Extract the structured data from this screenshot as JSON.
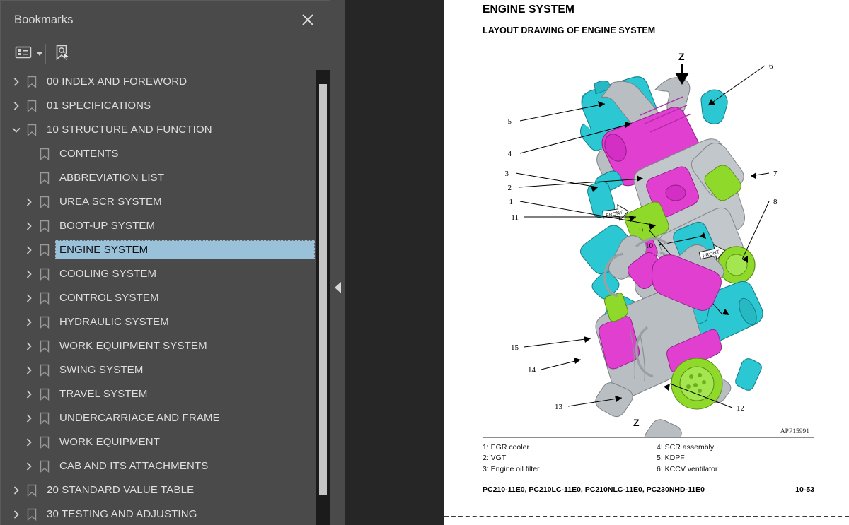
{
  "sidebar": {
    "title": "Bookmarks",
    "close_icon": "close-icon",
    "toolbar": {
      "list_options_icon": "list-options-icon",
      "find_bookmark_icon": "find-bookmark-icon"
    },
    "tree": [
      {
        "label": "00 INDEX AND FOREWORD",
        "level": 1,
        "expander": "collapsed",
        "selected": false
      },
      {
        "label": "01 SPECIFICATIONS",
        "level": 1,
        "expander": "collapsed",
        "selected": false
      },
      {
        "label": "10 STRUCTURE AND FUNCTION",
        "level": 1,
        "expander": "expanded",
        "selected": false
      },
      {
        "label": "CONTENTS",
        "level": 2,
        "expander": "none",
        "selected": false
      },
      {
        "label": "ABBREVIATION LIST",
        "level": 2,
        "expander": "none",
        "selected": false
      },
      {
        "label": "UREA SCR SYSTEM",
        "level": 2,
        "expander": "collapsed",
        "selected": false
      },
      {
        "label": "BOOT-UP SYSTEM",
        "level": 2,
        "expander": "collapsed",
        "selected": false
      },
      {
        "label": "ENGINE SYSTEM",
        "level": 2,
        "expander": "collapsed",
        "selected": true
      },
      {
        "label": "COOLING SYSTEM",
        "level": 2,
        "expander": "collapsed",
        "selected": false
      },
      {
        "label": "CONTROL SYSTEM",
        "level": 2,
        "expander": "collapsed",
        "selected": false
      },
      {
        "label": "HYDRAULIC SYSTEM",
        "level": 2,
        "expander": "collapsed",
        "selected": false
      },
      {
        "label": "WORK EQUIPMENT SYSTEM",
        "level": 2,
        "expander": "collapsed",
        "selected": false
      },
      {
        "label": "SWING SYSTEM",
        "level": 2,
        "expander": "collapsed",
        "selected": false
      },
      {
        "label": "TRAVEL SYSTEM",
        "level": 2,
        "expander": "collapsed",
        "selected": false
      },
      {
        "label": "UNDERCARRIAGE AND FRAME",
        "level": 2,
        "expander": "collapsed",
        "selected": false
      },
      {
        "label": "WORK EQUIPMENT",
        "level": 2,
        "expander": "collapsed",
        "selected": false
      },
      {
        "label": "CAB AND ITS ATTACHMENTS",
        "level": 2,
        "expander": "collapsed",
        "selected": false
      },
      {
        "label": "20 STANDARD VALUE TABLE",
        "level": 1,
        "expander": "collapsed",
        "selected": false
      },
      {
        "label": "30 TESTING AND ADJUSTING",
        "level": 1,
        "expander": "collapsed",
        "selected": false
      }
    ]
  },
  "viewer": {
    "collapse_handle_icon": "collapse-left-icon"
  },
  "document": {
    "title": "ENGINE SYSTEM",
    "subtitle": "LAYOUT DRAWING OF ENGINE SYSTEM",
    "figure_id": "APP15991",
    "view_labels": {
      "top_arrow": "Z",
      "bottom": "Z",
      "front_arrow": "FRONT"
    },
    "callouts_top": [
      "1",
      "2",
      "3",
      "4",
      "5",
      "6",
      "7",
      "8",
      "9",
      "10",
      "11"
    ],
    "callouts_bottom": [
      "12",
      "13",
      "14",
      "15"
    ],
    "legend_left": [
      "1: EGR cooler",
      "2: VGT",
      "3: Engine oil filter"
    ],
    "legend_right": [
      "4: SCR assembly",
      "5: KDPF",
      "6: KCCV ventilator"
    ],
    "footer_models": "PC210-11E0, PC210LC-11E0, PC210NLC-11E0, PC230NHD-11E0",
    "footer_page": "10-53"
  },
  "colors": {
    "panel_bg": "#4a4a4a",
    "viewer_bg": "#262626",
    "selection": "#9ac1da",
    "text": "#dedede",
    "part_cyan": "#2bc8d4",
    "part_magenta": "#e03fd0",
    "part_green": "#8fd92b",
    "part_gray": "#b9bec2"
  }
}
